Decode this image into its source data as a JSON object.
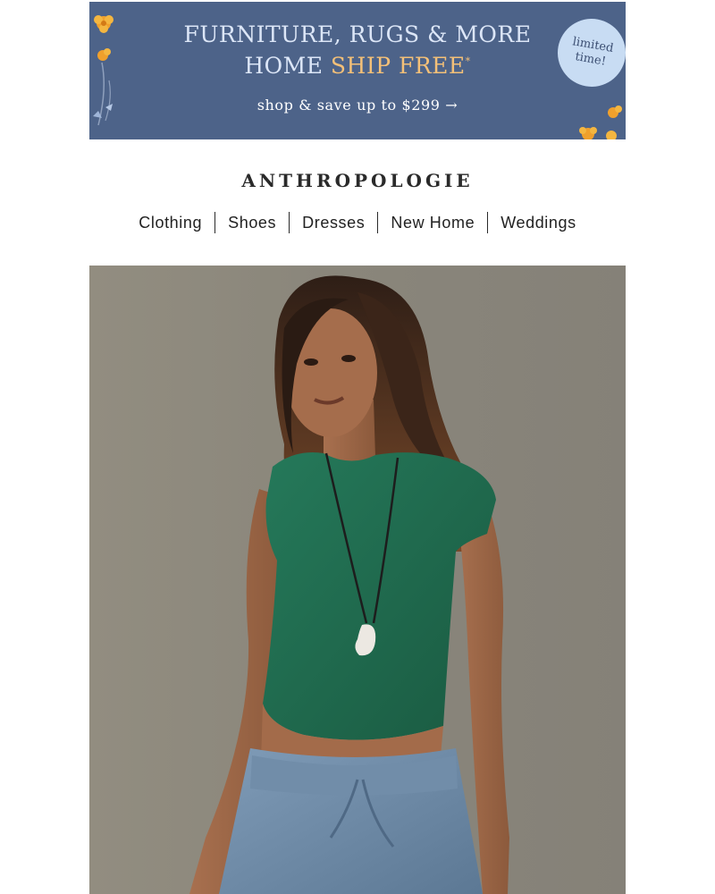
{
  "banner": {
    "headline_line1": "FURNITURE, RUGS & MORE",
    "headline_line2_prefix": "HOME ",
    "headline_line2_highlight": "SHIP FREE",
    "headline_asterisk": "*",
    "cta": "shop & save up to $299 →",
    "badge_line1": "limited",
    "badge_line2": "time!",
    "colors": {
      "background": "#4d6389",
      "text": "#dce6f7",
      "highlight": "#f4c078",
      "badge": "#c8dcf3"
    }
  },
  "brand": {
    "logo": "ANTHROPOLOGIE"
  },
  "nav": {
    "items": [
      {
        "label": "Clothing"
      },
      {
        "label": "Shoes"
      },
      {
        "label": "Dresses"
      },
      {
        "label": "New Home"
      },
      {
        "label": "Weddings"
      }
    ]
  },
  "hero": {
    "image": "model-green-sleeveless-top-blue-pants",
    "colors": {
      "top": "#1f6a4c",
      "pants": "#6d8aa6",
      "backdrop": "#8a867b"
    }
  }
}
